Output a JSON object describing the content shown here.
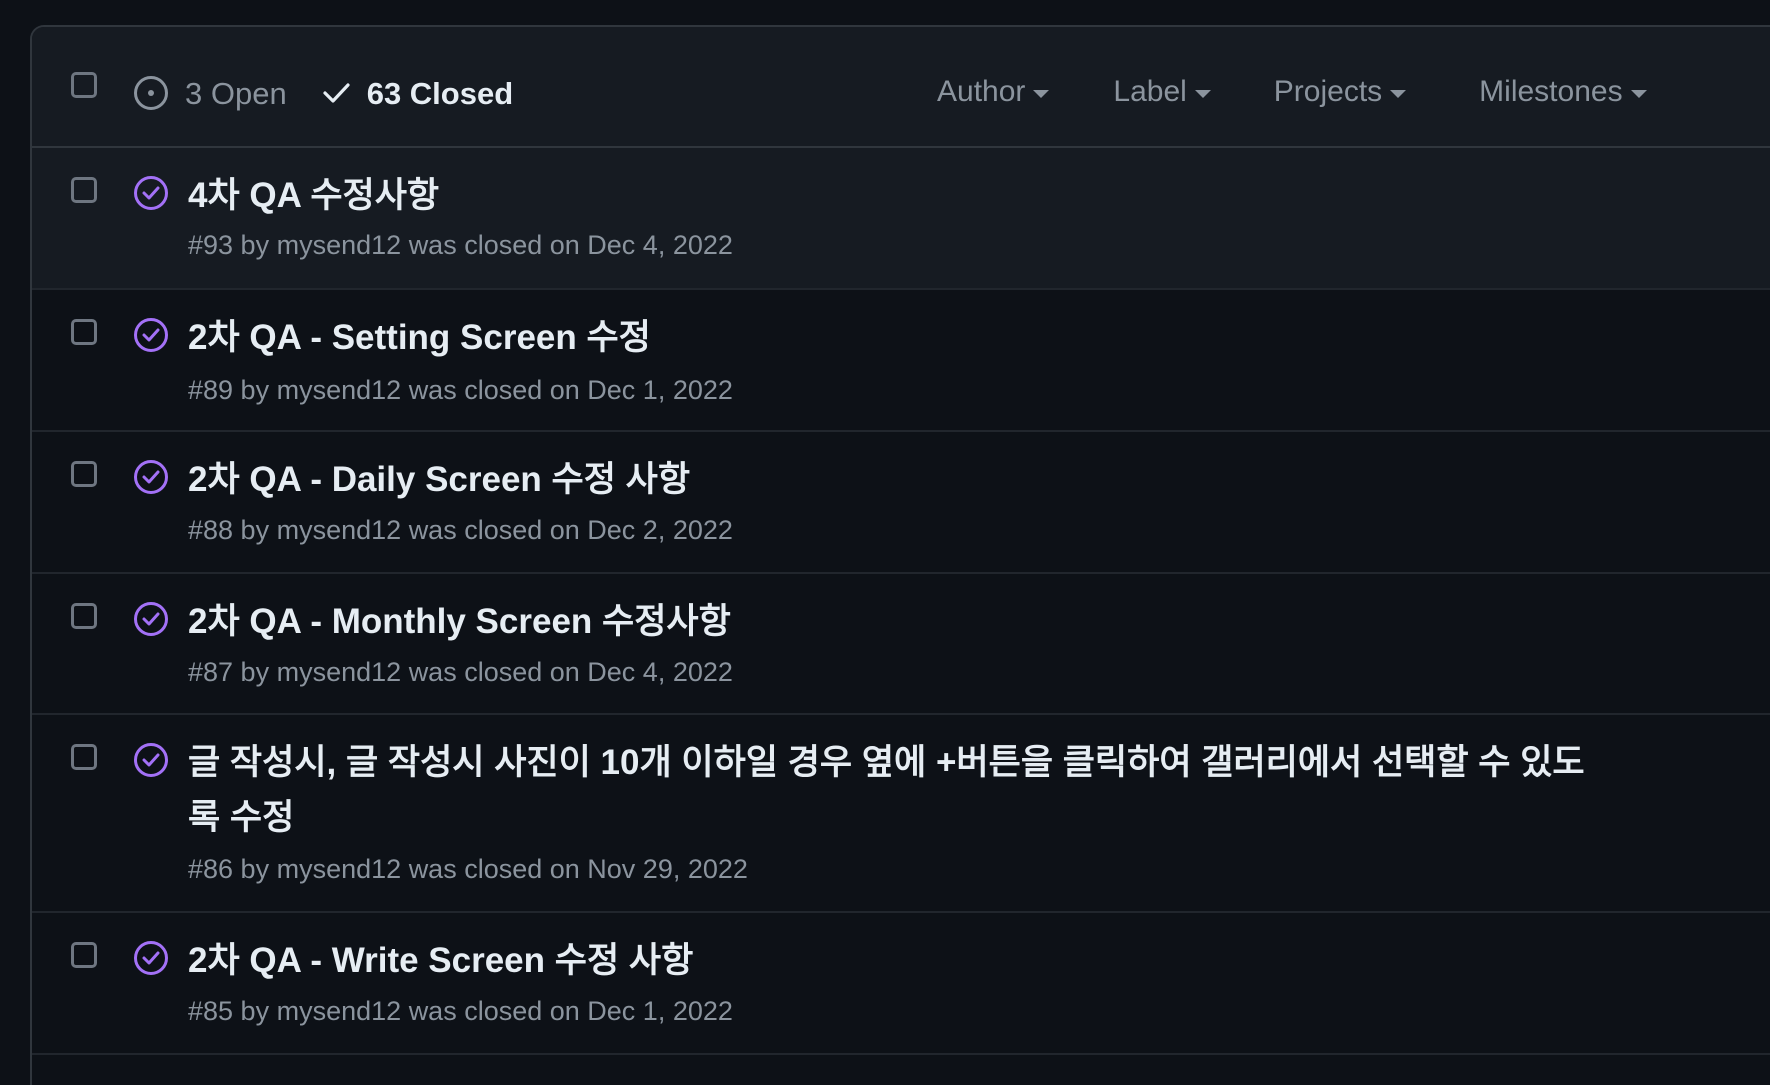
{
  "header": {
    "open_label": "3 Open",
    "closed_label": "63 Closed",
    "filters": [
      {
        "label": "Author"
      },
      {
        "label": "Label"
      },
      {
        "label": "Projects"
      },
      {
        "label": "Milestones"
      }
    ]
  },
  "issues": [
    {
      "title": "4차 QA 수정사항",
      "meta_prefix": "#93 by",
      "author": "mysend12",
      "meta_suffix": "was closed on Dec 4, 2022"
    },
    {
      "title": "2차 QA - Setting Screen 수정",
      "meta_prefix": "#89 by",
      "author": "mysend12",
      "meta_suffix": "was closed on Dec 1, 2022"
    },
    {
      "title": "2차 QA - Daily Screen 수정 사항",
      "meta_prefix": "#88 by",
      "author": "mysend12",
      "meta_suffix": "was closed on Dec 2, 2022"
    },
    {
      "title": "2차 QA - Monthly Screen 수정사항",
      "meta_prefix": "#87 by",
      "author": "mysend12",
      "meta_suffix": "was closed on Dec 4, 2022"
    },
    {
      "title": "글 작성시, 글 작성시 사진이 10개 이하일 경우 옆에 +버튼을 클릭하여 갤러리에서 선택할 수 있도록 수정",
      "meta_prefix": "#86 by",
      "author": "mysend12",
      "meta_suffix": "was closed on Nov 29, 2022"
    },
    {
      "title": "2차 QA - Write Screen 수정 사항",
      "meta_prefix": "#85 by",
      "author": "mysend12",
      "meta_suffix": "was closed on Dec 1, 2022"
    }
  ],
  "colors": {
    "background": "#0d1117",
    "header_background": "#161b22",
    "border": "#30363d",
    "closed_icon": "#a371f7",
    "muted_text": "#8b949e",
    "primary_text": "#e6edf3"
  }
}
